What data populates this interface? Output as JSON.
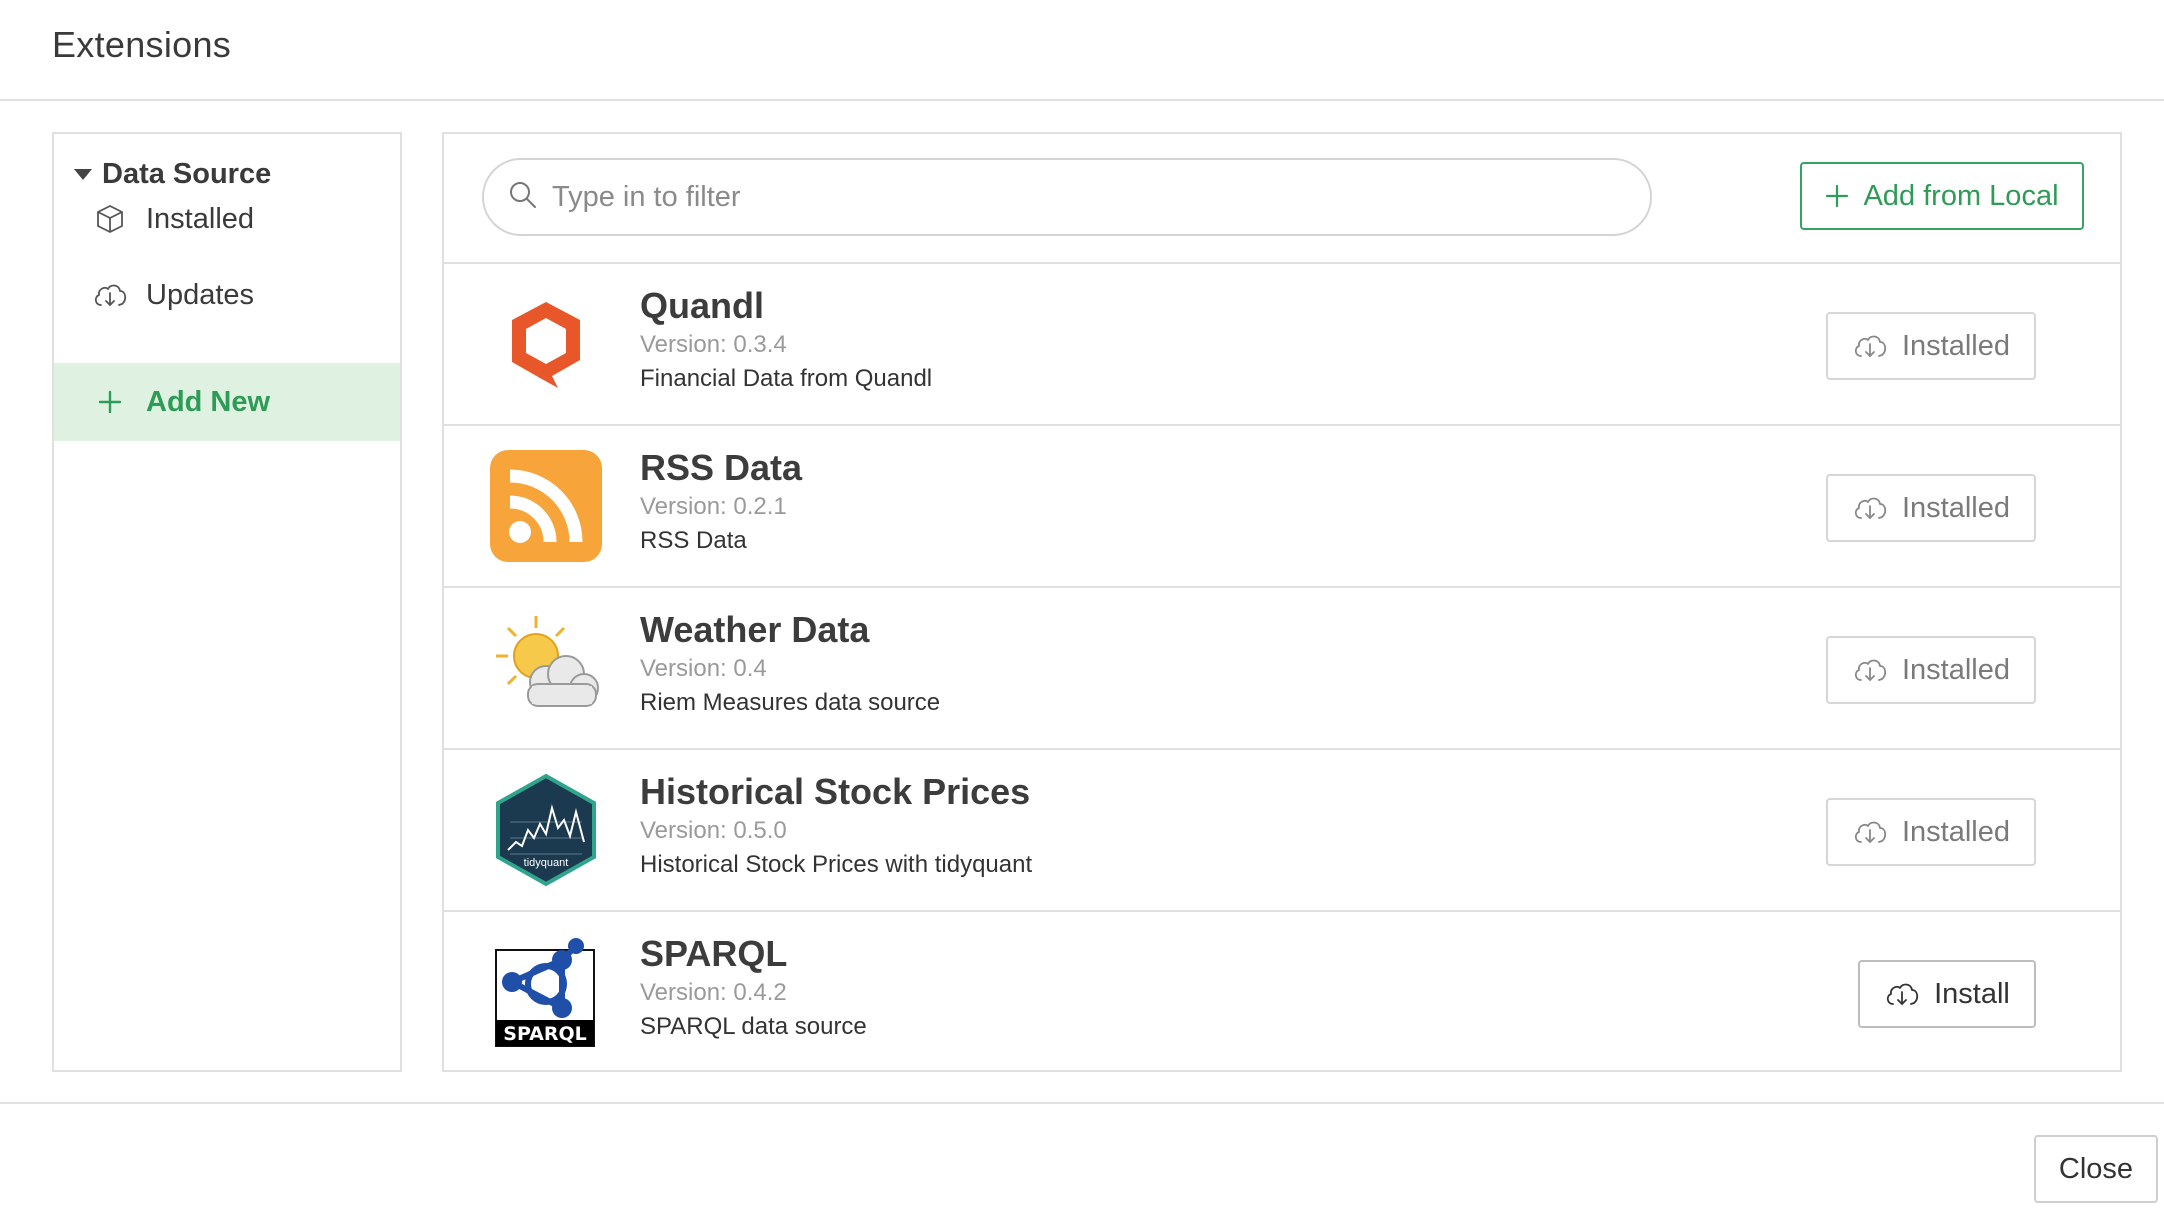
{
  "dialog": {
    "title": "Extensions"
  },
  "sidebar": {
    "group_label": "Data Source",
    "items": [
      {
        "label": "Installed",
        "icon": "cube-icon"
      },
      {
        "label": "Updates",
        "icon": "cloud-download-icon"
      },
      {
        "label": "Add New",
        "icon": "plus-icon",
        "active": true
      }
    ]
  },
  "search": {
    "placeholder": "Type in to filter",
    "value": ""
  },
  "toolbar": {
    "add_local_label": "Add from Local"
  },
  "extensions": [
    {
      "name": "Quandl",
      "version": "Version: 0.3.4",
      "description": "Financial Data from Quandl",
      "status": "Installed",
      "logo": "quandl-logo"
    },
    {
      "name": "RSS Data",
      "version": "Version: 0.2.1",
      "description": "RSS Data",
      "status": "Installed",
      "logo": "rss-logo"
    },
    {
      "name": "Weather Data",
      "version": "Version: 0.4",
      "description": "Riem Measures data source",
      "status": "Installed",
      "logo": "weather-logo"
    },
    {
      "name": "Historical Stock Prices",
      "version": "Version: 0.5.0",
      "description": "Historical Stock Prices with tidyquant",
      "status": "Installed",
      "logo": "tidyquant-logo",
      "logo_text": "tidyquant"
    },
    {
      "name": "SPARQL",
      "version": "Version: 0.4.2",
      "description": "SPARQL data source",
      "status": "Install",
      "logo": "sparql-logo",
      "logo_text": "SPARQL"
    }
  ],
  "footer": {
    "close_label": "Close"
  },
  "colors": {
    "accent_green": "#2e9b57",
    "active_bg": "#dff2e2",
    "rss_orange": "#f7a43a",
    "quandl_orange": "#e8572a",
    "sparql_blue": "#1f4fa8"
  }
}
